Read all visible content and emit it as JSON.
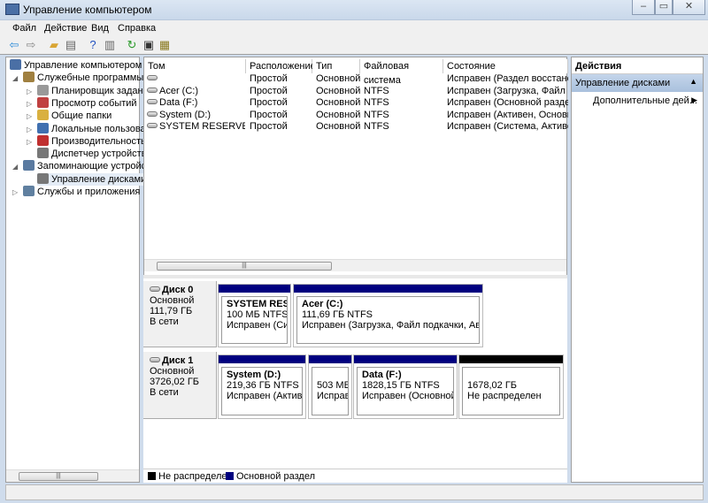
{
  "window": {
    "title": "Управление компьютером",
    "minimize": "–",
    "maximize": "▭",
    "close": "✕"
  },
  "menu": [
    "Файл",
    "Действие",
    "Вид",
    "Справка"
  ],
  "toolbar": [
    {
      "icon": "back-arrow-icon",
      "g": "⇦",
      "c": "#2b8ad8"
    },
    {
      "icon": "forward-arrow-icon",
      "g": "⇨",
      "c": "#888"
    },
    {
      "icon": "up-folder-icon",
      "g": "▰",
      "c": "#d9a534"
    },
    {
      "icon": "show-hide-tree-icon",
      "g": "▤",
      "c": "#666"
    },
    {
      "icon": "help-icon",
      "g": "?",
      "c": "#2050c0"
    },
    {
      "icon": "show-hide-action-pane-icon",
      "g": "▥",
      "c": "#666"
    },
    {
      "icon": "refresh-icon",
      "g": "↻",
      "c": "#2a9a2a"
    },
    {
      "icon": "properties-icon",
      "g": "▣",
      "c": "#333"
    },
    {
      "icon": "settings-icon",
      "g": "▦",
      "c": "#8a7a20"
    }
  ],
  "tree": [
    {
      "label": "Управление компьютером (л",
      "level": 0,
      "exp": "",
      "color": "#4a6fa5"
    },
    {
      "label": "Служебные программы",
      "level": 1,
      "exp": "◢",
      "color": "#a08040"
    },
    {
      "label": "Планировщик заданий",
      "level": 2,
      "exp": "▷",
      "color": "#999"
    },
    {
      "label": "Просмотр событий",
      "level": 2,
      "exp": "▷",
      "color": "#c04040"
    },
    {
      "label": "Общие папки",
      "level": 2,
      "exp": "▷",
      "color": "#d9b040"
    },
    {
      "label": "Локальные пользовате",
      "level": 2,
      "exp": "▷",
      "color": "#4070b0"
    },
    {
      "label": "Производительность",
      "level": 2,
      "exp": "▷",
      "color": "#c03030"
    },
    {
      "label": "Диспетчер устройств",
      "level": 2,
      "exp": "",
      "color": "#777"
    },
    {
      "label": "Запоминающие устройст",
      "level": 1,
      "exp": "◢",
      "color": "#5a7aa0"
    },
    {
      "label": "Управление дисками",
      "level": 2,
      "exp": "",
      "color": "#777",
      "selected": true
    },
    {
      "label": "Службы и приложения",
      "level": 1,
      "exp": "▷",
      "color": "#6080a0"
    }
  ],
  "volumes": {
    "columns": [
      "Том",
      "Расположение",
      "Тип",
      "Файловая система",
      "Состояние"
    ],
    "rows": [
      [
        "",
        "Простой",
        "Основной",
        "",
        "Исправен (Раздел восстановле"
      ],
      [
        "Acer (C:)",
        "Простой",
        "Основной",
        "NTFS",
        "Исправен (Загрузка, Файл подк"
      ],
      [
        "Data (F:)",
        "Простой",
        "Основной",
        "NTFS",
        "Исправен (Основной раздел)"
      ],
      [
        "System (D:)",
        "Простой",
        "Основной",
        "NTFS",
        "Исправен (Активен, Основной"
      ],
      [
        "SYSTEM RESERVED (E:)",
        "Простой",
        "Основной",
        "NTFS",
        "Исправен (Система, Активен, С"
      ]
    ]
  },
  "disks": [
    {
      "name": "Диск 0",
      "type": "Основной",
      "size": "111,79 ГБ",
      "status": "В сети",
      "parts": [
        {
          "name": "SYSTEM RESERV",
          "size": "100 МБ NTFS",
          "state": "Исправен (Систе",
          "kind": "primary"
        },
        {
          "name": "Acer  (C:)",
          "size": "111,69 ГБ NTFS",
          "state": "Исправен (Загрузка, Файл подкачки, Аварийн",
          "kind": "primary"
        }
      ]
    },
    {
      "name": "Диск 1",
      "type": "Основной",
      "size": "3726,02 ГБ",
      "status": "В сети",
      "parts": [
        {
          "name": "System  (D:)",
          "size": "219,36 ГБ NTFS",
          "state": "Исправен (Активен,",
          "kind": "primary"
        },
        {
          "name": "",
          "size": "503 МБ",
          "state": "Исправе",
          "kind": "primary"
        },
        {
          "name": "Data  (F:)",
          "size": "1828,15 ГБ NTFS",
          "state": "Исправен (Основной ра",
          "kind": "primary"
        },
        {
          "name": "",
          "size": "1678,02 ГБ",
          "state": "Не распределен",
          "kind": "unallocated"
        }
      ]
    }
  ],
  "legend": [
    {
      "label": "Не распределен",
      "color": "#000000"
    },
    {
      "label": "Основной раздел",
      "color": "#00007f"
    }
  ],
  "actions": {
    "title": "Действия",
    "section": "Управление дисками",
    "item": "Дополнительные дей..."
  },
  "colors": {
    "primary": "#00007f",
    "unallocated": "#000000"
  }
}
